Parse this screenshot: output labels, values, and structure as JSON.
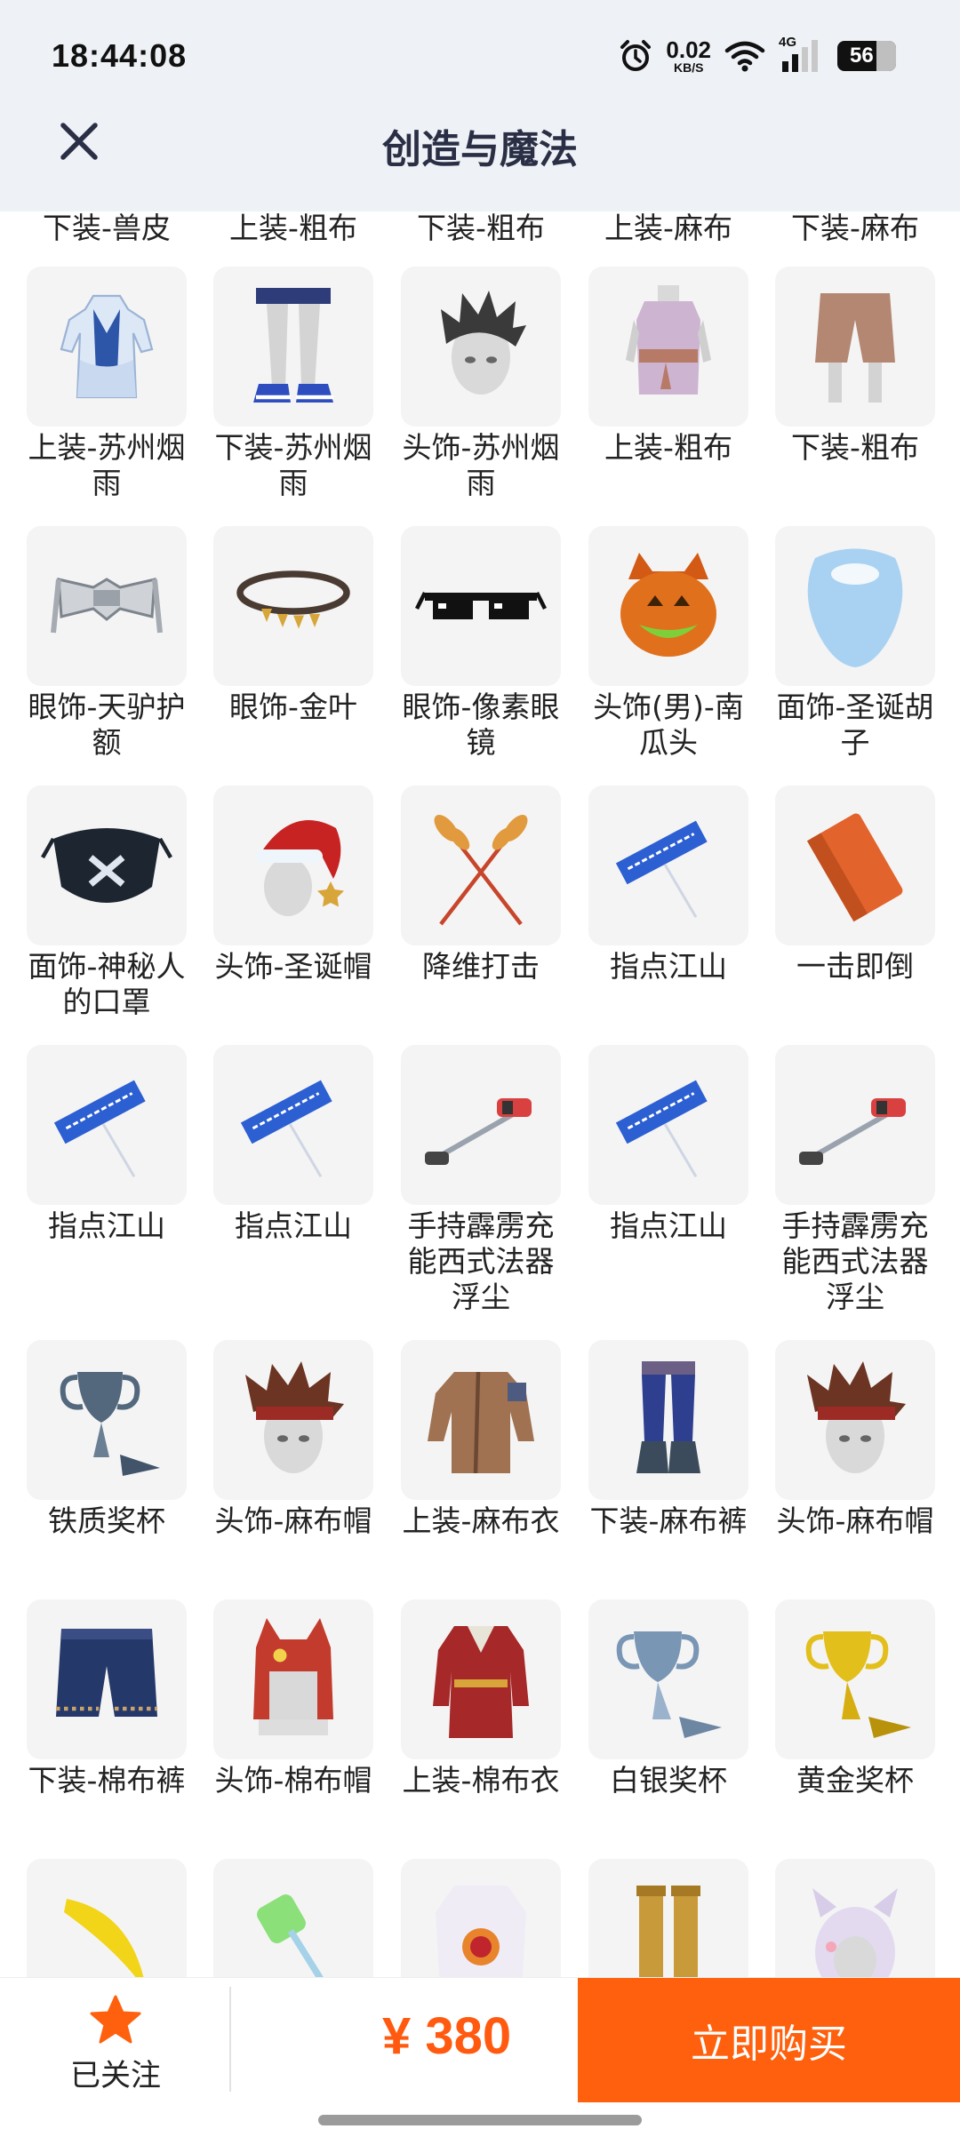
{
  "status_bar": {
    "time": "18:44:08",
    "net_speed_value": "0.02",
    "net_speed_unit": "KB/S",
    "network_type": "4G",
    "battery": "56"
  },
  "header": {
    "title": "创造与魔法",
    "close_icon": "close-icon"
  },
  "partial_row": [
    "下装-兽皮",
    "上装-粗布",
    "下装-粗布",
    "上装-麻布",
    "下装-麻布"
  ],
  "items": [
    {
      "label": "上装-苏州烟雨",
      "icon": "blue-robe"
    },
    {
      "label": "下装-苏州烟雨",
      "icon": "shorts-sneakers"
    },
    {
      "label": "头饰-苏州烟雨",
      "icon": "spiky-hair-head"
    },
    {
      "label": "上装-粗布",
      "icon": "sash-tunic"
    },
    {
      "label": "下装-粗布",
      "icon": "brown-shorts"
    },
    {
      "label": "眼饰-天驴护额",
      "icon": "silver-headguard"
    },
    {
      "label": "眼饰-金叶",
      "icon": "gold-leaf-band"
    },
    {
      "label": "眼饰-像素眼镜",
      "icon": "pixel-glasses"
    },
    {
      "label": "头饰(男)-南瓜头",
      "icon": "pumpkin-head"
    },
    {
      "label": "面饰-圣诞胡子",
      "icon": "santa-beard"
    },
    {
      "label": "面饰-神秘人的口罩",
      "icon": "face-mask"
    },
    {
      "label": "头饰-圣诞帽",
      "icon": "santa-hat-head"
    },
    {
      "label": "降维打击",
      "icon": "crossed-wheat"
    },
    {
      "label": "指点江山",
      "icon": "banner-flag"
    },
    {
      "label": "一击即倒",
      "icon": "brick"
    },
    {
      "label": "指点江山",
      "icon": "banner-flag"
    },
    {
      "label": "指点江山",
      "icon": "banner-flag"
    },
    {
      "label": "手持霹雳充能西式法器浮尘",
      "icon": "vacuum-cleaner"
    },
    {
      "label": "指点江山",
      "icon": "banner-flag"
    },
    {
      "label": "手持霹雳充能西式法器浮尘",
      "icon": "vacuum-cleaner"
    },
    {
      "label": "铁质奖杯",
      "icon": "iron-trophy"
    },
    {
      "label": "头饰-麻布帽",
      "icon": "headband-head"
    },
    {
      "label": "上装-麻布衣",
      "icon": "leather-jacket"
    },
    {
      "label": "下装-麻布裤",
      "icon": "blue-pants-boots"
    },
    {
      "label": "头饰-麻布帽",
      "icon": "headband-head"
    },
    {
      "label": "下装-棉布裤",
      "icon": "denim-shorts"
    },
    {
      "label": "头饰-棉布帽",
      "icon": "red-monster-hood"
    },
    {
      "label": "上装-棉布衣",
      "icon": "red-coat"
    },
    {
      "label": "白银奖杯",
      "icon": "silver-trophy"
    },
    {
      "label": "黄金奖杯",
      "icon": "gold-trophy"
    },
    {
      "label": "",
      "icon": "banana"
    },
    {
      "label": "",
      "icon": "toy-hammer"
    },
    {
      "label": "",
      "icon": "white-medal-shirt"
    },
    {
      "label": "",
      "icon": "gold-boots"
    },
    {
      "label": "",
      "icon": "purple-animal-hood"
    }
  ],
  "bottom_bar": {
    "follow_label": "已关注",
    "follow_icon": "star-icon",
    "price": "¥ 380",
    "buy_label": "立即购买"
  },
  "colors": {
    "accent": "#ff600d",
    "price": "#ff5a0f",
    "header_bg": "#eef1f5",
    "title": "#2a2f45"
  }
}
